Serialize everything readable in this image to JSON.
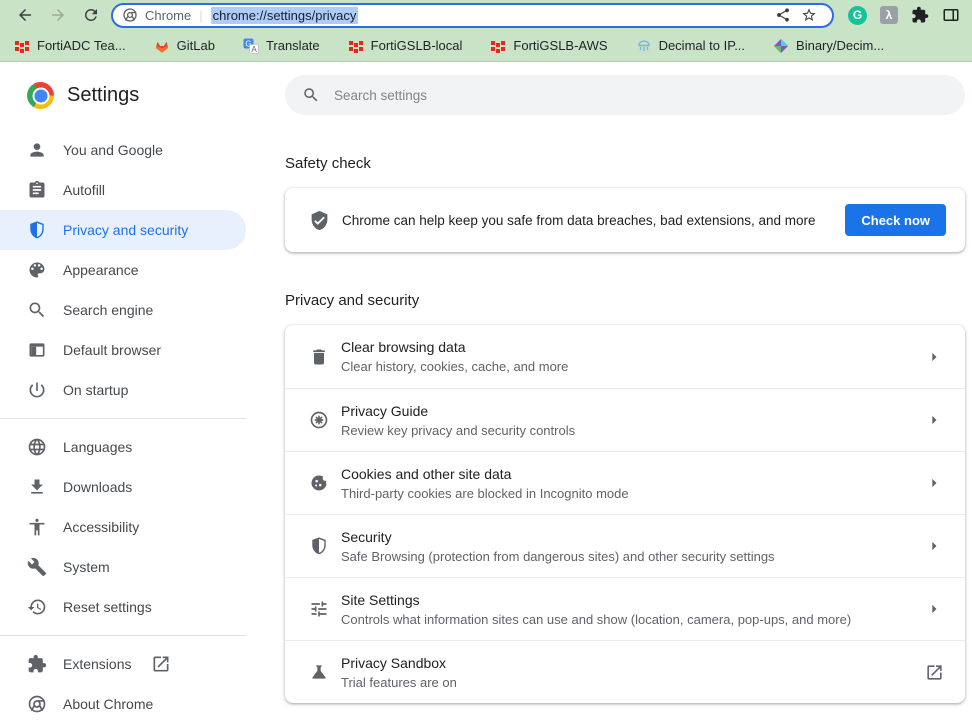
{
  "toolbar": {
    "site_label": "Chrome",
    "url": "chrome://settings/privacy"
  },
  "bookmarks_bar": {
    "items": [
      {
        "label": "FortiADC Tea...",
        "icon": "fortinet-favicon"
      },
      {
        "label": "GitLab",
        "icon": "gitlab-favicon"
      },
      {
        "label": "Translate",
        "icon": "translate-favicon"
      },
      {
        "label": "FortiGSLB-local",
        "icon": "fortinet-favicon"
      },
      {
        "label": "FortiGSLB-AWS",
        "icon": "fortinet-favicon"
      },
      {
        "label": "Decimal to IP...",
        "icon": "decimal-ip-favicon"
      },
      {
        "label": "Binary/Decim...",
        "icon": "binary-favicon"
      }
    ]
  },
  "sidebar": {
    "title": "Settings",
    "items": [
      {
        "label": "You and Google",
        "icon": "person-icon",
        "selected": false
      },
      {
        "label": "Autofill",
        "icon": "autofill-icon",
        "selected": false
      },
      {
        "label": "Privacy and security",
        "icon": "privacy-shield-icon",
        "selected": true
      },
      {
        "label": "Appearance",
        "icon": "palette-icon",
        "selected": false
      },
      {
        "label": "Search engine",
        "icon": "search-icon",
        "selected": false
      },
      {
        "label": "Default browser",
        "icon": "browser-window-icon",
        "selected": false
      },
      {
        "label": "On startup",
        "icon": "power-icon",
        "selected": false
      },
      {
        "label": "Languages",
        "icon": "globe-icon",
        "selected": false
      },
      {
        "label": "Downloads",
        "icon": "download-icon",
        "selected": false
      },
      {
        "label": "Accessibility",
        "icon": "accessibility-icon",
        "selected": false
      },
      {
        "label": "System",
        "icon": "wrench-icon",
        "selected": false
      },
      {
        "label": "Reset settings",
        "icon": "history-icon",
        "selected": false
      },
      {
        "label": "Extensions",
        "icon": "puzzle-icon",
        "selected": false,
        "external": true
      },
      {
        "label": "About Chrome",
        "icon": "chrome-outline-icon",
        "selected": false
      }
    ]
  },
  "search": {
    "placeholder": "Search settings"
  },
  "safety_check": {
    "heading": "Safety check",
    "message": "Chrome can help keep you safe from data breaches, bad extensions, and more",
    "button_label": "Check now"
  },
  "privacy_section": {
    "heading": "Privacy and security",
    "rows": [
      {
        "title": "Clear browsing data",
        "subtitle": "Clear history, cookies, cache, and more",
        "icon": "trash-icon",
        "trailing": "chevron"
      },
      {
        "title": "Privacy Guide",
        "subtitle": "Review key privacy and security controls",
        "icon": "privacy-guide-icon",
        "trailing": "chevron"
      },
      {
        "title": "Cookies and other site data",
        "subtitle": "Third-party cookies are blocked in Incognito mode",
        "icon": "cookie-icon",
        "trailing": "chevron"
      },
      {
        "title": "Security",
        "subtitle": "Safe Browsing (protection from dangerous sites) and other security settings",
        "icon": "security-shield-icon",
        "trailing": "chevron"
      },
      {
        "title": "Site Settings",
        "subtitle": "Controls what information sites can use and show (location, camera, pop-ups, and more)",
        "icon": "tune-icon",
        "trailing": "chevron"
      },
      {
        "title": "Privacy Sandbox",
        "subtitle": "Trial features are on",
        "icon": "flask-icon",
        "trailing": "open-in-new"
      }
    ]
  },
  "colors": {
    "accent": "#1a73e8",
    "toolbar_background": "#c9e3c7",
    "selected_item_background": "#e8f0fe",
    "url_selection_background": "#aecbfa",
    "grammarly_green": "#15c39a",
    "fortinet_red": "#e8271f",
    "gitlab_orange": "#e24329"
  }
}
